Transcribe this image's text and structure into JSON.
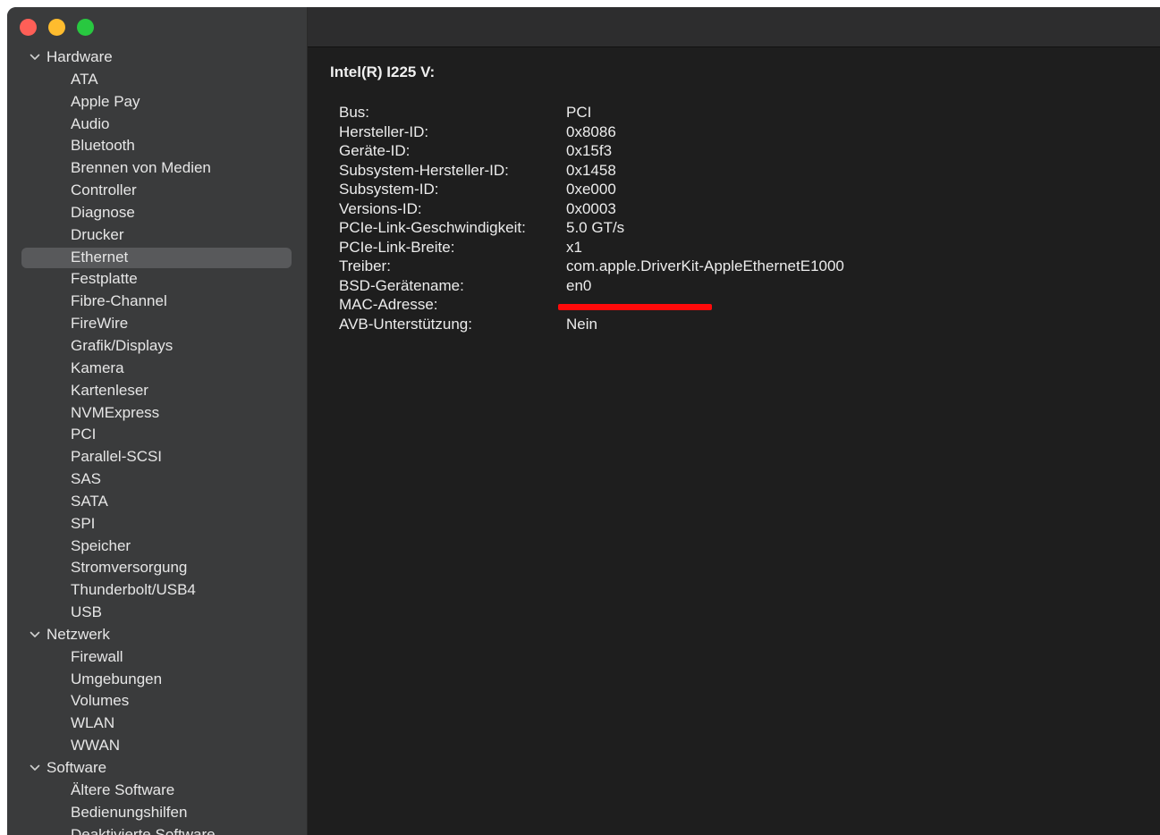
{
  "window": {
    "controls": [
      "close",
      "minimize",
      "maximize"
    ]
  },
  "sidebar": {
    "groups": [
      {
        "label": "Hardware",
        "items": [
          "ATA",
          "Apple Pay",
          "Audio",
          "Bluetooth",
          "Brennen von Medien",
          "Controller",
          "Diagnose",
          "Drucker",
          "Ethernet",
          "Festplatte",
          "Fibre-Channel",
          "FireWire",
          "Grafik/Displays",
          "Kamera",
          "Kartenleser",
          "NVMExpress",
          "PCI",
          "Parallel-SCSI",
          "SAS",
          "SATA",
          "SPI",
          "Speicher",
          "Stromversorgung",
          "Thunderbolt/USB4",
          "USB"
        ]
      },
      {
        "label": "Netzwerk",
        "items": [
          "Firewall",
          "Umgebungen",
          "Volumes",
          "WLAN",
          "WWAN"
        ]
      },
      {
        "label": "Software",
        "items": [
          "Ältere Software",
          "Bedienungshilfen",
          "Deaktivierte Software"
        ]
      }
    ],
    "selected": "Ethernet"
  },
  "detail": {
    "title": "Intel(R) I225 V:",
    "properties": [
      {
        "key": "Bus:",
        "value": "PCI"
      },
      {
        "key": "Hersteller-ID:",
        "value": "0x8086"
      },
      {
        "key": "Geräte-ID:",
        "value": "0x15f3"
      },
      {
        "key": "Subsystem-Hersteller-ID:",
        "value": "0x1458"
      },
      {
        "key": "Subsystem-ID:",
        "value": "0xe000"
      },
      {
        "key": "Versions-ID:",
        "value": "0x0003"
      },
      {
        "key": "PCIe-Link-Geschwindigkeit:",
        "value": "5.0 GT/s"
      },
      {
        "key": "PCIe-Link-Breite:",
        "value": "x1"
      },
      {
        "key": "Treiber:",
        "value": "com.apple.DriverKit-AppleEthernetE1000"
      },
      {
        "key": "BSD-Gerätename:",
        "value": "en0"
      },
      {
        "key": "MAC-Adresse:",
        "value": "",
        "redacted": true
      },
      {
        "key": "AVB-Unterstützung:",
        "value": "Nein"
      }
    ]
  },
  "colors": {
    "sidebar_bg": "#3a3b3c",
    "content_bg": "#1e1e1e",
    "selection": "#58595b",
    "redaction": "#ff0a0a"
  }
}
